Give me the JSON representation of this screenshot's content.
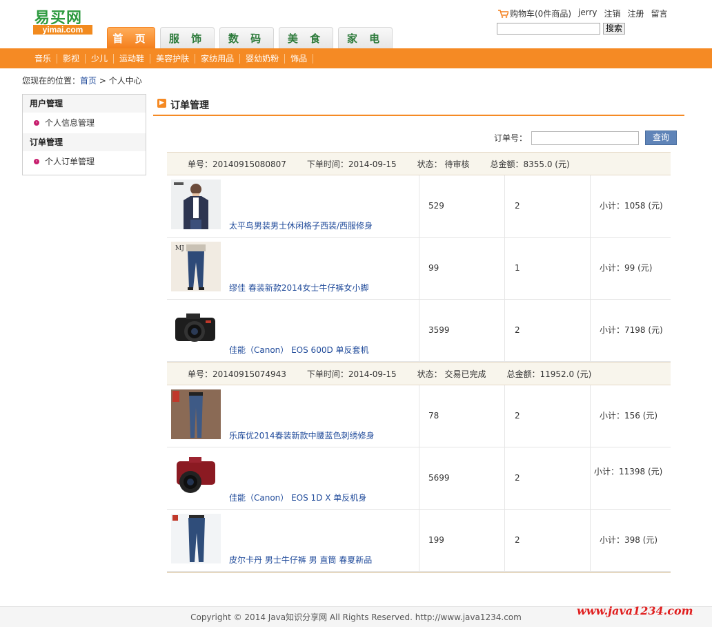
{
  "logo": {
    "cn": "易买网",
    "en": "yimai.com"
  },
  "nav_tabs": [
    "首 页",
    "服 饰",
    "数 码",
    "美 食",
    "家 电"
  ],
  "top_links": {
    "cart": "购物车(0件商品)",
    "user": "jerry",
    "logout": "注销",
    "register": "注册",
    "message": "留言"
  },
  "search": {
    "button": "搜索"
  },
  "categories": [
    "音乐",
    "影视",
    "少儿",
    "运动鞋",
    "美容护肤",
    "家纺用品",
    "婴幼奶粉",
    "饰品"
  ],
  "breadcrumb": {
    "prefix": "您现在的位置：",
    "home": "首页",
    "sep": " > ",
    "current": "个人中心"
  },
  "sidebar": {
    "group1": "用户管理",
    "item1": "个人信息管理",
    "group2": "订单管理",
    "item2": "个人订单管理"
  },
  "main": {
    "title": "订单管理",
    "order_no_label": "订单号：",
    "query_button": "查询"
  },
  "orders": [
    {
      "no": "单号：20140915080807",
      "time": "下单时间：2014-09-15",
      "status": "状态：  待审核",
      "total": "总金额：8355.0 (元)",
      "items": [
        {
          "name": "太平鸟男装男士休闲格子西装/西服修身",
          "price": "529",
          "qty": "2",
          "subtotal": "小计：1058 (元)",
          "image": "man-suit"
        },
        {
          "name": "缪佳 春装新款2014女士牛仔裤女小脚",
          "price": "99",
          "qty": "1",
          "subtotal": "小计：99 (元)",
          "image": "woman-jeans"
        },
        {
          "name": "佳能（Canon） EOS 600D 单反套机",
          "price": "3599",
          "qty": "2",
          "subtotal": "小计：7198 (元)",
          "image": "camera-black"
        }
      ]
    },
    {
      "no": "单号：20140915074943",
      "time": "下单时间：2014-09-15",
      "status": "状态：  交易已完成",
      "total": "总金额：11952.0 (元)",
      "items": [
        {
          "name": "乐库优2014春装新款中腰蓝色刺绣修身",
          "price": "78",
          "qty": "2",
          "subtotal": "小计：156 (元)",
          "image": "woman-jeans-2"
        },
        {
          "name": "佳能（Canon） EOS 1D X 单反机身",
          "price": "5699",
          "qty": "2",
          "subtotal": "小计：11398 (元)",
          "image": "camera-red"
        },
        {
          "name": "皮尔卡丹 男士牛仔裤 男 直筒 春夏新品",
          "price": "199",
          "qty": "2",
          "subtotal": "小计：398 (元)",
          "image": "man-jeans"
        }
      ]
    }
  ],
  "footer": "Copyright © 2014 Java知识分享网 All Rights Reserved. http://www.java1234.com",
  "watermark": "www.java1234.com",
  "colors": {
    "accent": "#f58a24",
    "link": "#1f4a9a",
    "logo_green": "#2d9a3f"
  }
}
